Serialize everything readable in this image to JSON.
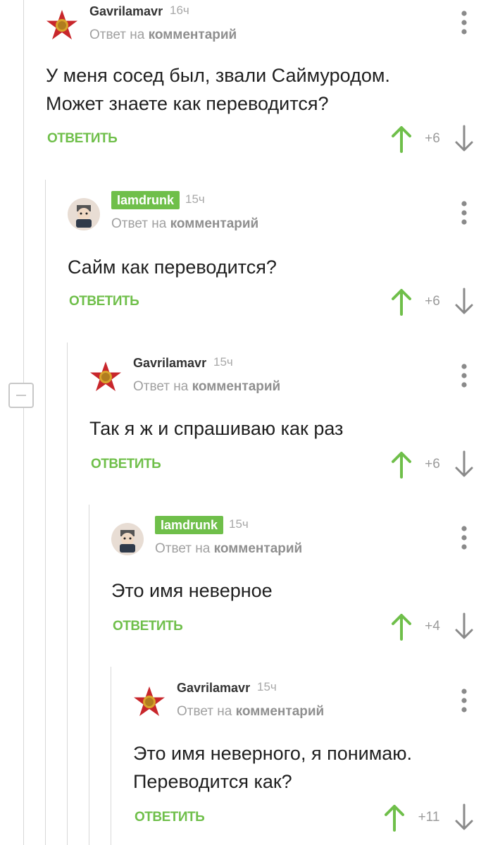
{
  "comments": [
    {
      "author": "Gavrilamavr",
      "time": "16ч",
      "reply_prefix": "Ответ на",
      "reply_target": "комментарий",
      "lines": [
        "У меня сосед был, звали Саймуродом.",
        "Может знаете как переводится?"
      ],
      "reply_label": "ОТВЕТИТЬ",
      "score": "+6",
      "avatar": "red-star-icon"
    },
    {
      "author": "Iamdrunk",
      "time": "15ч",
      "reply_prefix": "Ответ на",
      "reply_target": "комментарий",
      "lines": [
        "Сайм как переводится?"
      ],
      "reply_label": "ОТВЕТИТЬ",
      "score": "+6",
      "avatar": "cartoon-avatar-icon"
    },
    {
      "author": "Gavrilamavr",
      "time": "15ч",
      "reply_prefix": "Ответ на",
      "reply_target": "комментарий",
      "lines": [
        "Так я ж и спрашиваю как раз"
      ],
      "reply_label": "ОТВЕТИТЬ",
      "score": "+6",
      "avatar": "red-star-icon"
    },
    {
      "author": "Iamdrunk",
      "time": "15ч",
      "reply_prefix": "Ответ на",
      "reply_target": "комментарий",
      "lines": [
        "Это имя неверное"
      ],
      "reply_label": "ОТВЕТИТЬ",
      "score": "+4",
      "avatar": "cartoon-avatar-icon"
    },
    {
      "author": "Gavrilamavr",
      "time": "15ч",
      "reply_prefix": "Ответ на",
      "reply_target": "комментарий",
      "lines": [
        "Это имя неверного, я понимаю.",
        "Переводится как?"
      ],
      "reply_label": "ОТВЕТИТЬ",
      "score": "+11",
      "avatar": "red-star-icon"
    }
  ],
  "colors": {
    "accent_green": "#6fbf4a",
    "muted_gray": "#a0a0a0",
    "thread_line": "#d8d8d8"
  }
}
